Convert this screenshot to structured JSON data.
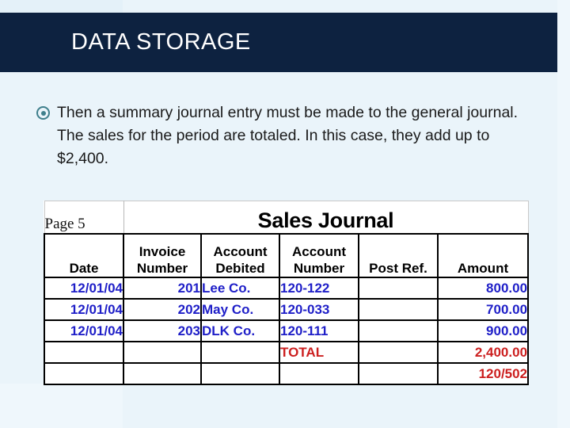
{
  "slide": {
    "title": "DATA STORAGE",
    "accent_dark": "#0d2240",
    "background": "#eaf4fa",
    "bullet_color": "#3f7f8c",
    "body_text": "Then a summary journal entry must be made to the general journal. The sales for the period are totaled. In this case, they add up to $2,400.",
    "bullet_icon": "circled-dot-bullet-icon"
  },
  "journal": {
    "page_label": "Page 5",
    "title": "Sales Journal",
    "value_color_blue": "#1f1fc8",
    "value_color_red": "#cc1f1f",
    "columns": [
      {
        "line1": "",
        "line2": "Date"
      },
      {
        "line1": "Invoice",
        "line2": "Number"
      },
      {
        "line1": "Account",
        "line2": "Debited"
      },
      {
        "line1": "Account",
        "line2": "Number"
      },
      {
        "line1": "",
        "line2": "Post Ref."
      },
      {
        "line1": "",
        "line2": "Amount"
      }
    ],
    "rows": [
      {
        "date": "12/01/04",
        "invoice": "201",
        "account_debited": "Lee Co.",
        "account_number": "120-122",
        "post_ref": "",
        "amount": "800.00"
      },
      {
        "date": "12/01/04",
        "invoice": "202",
        "account_debited": "May Co.",
        "account_number": "120-033",
        "post_ref": "",
        "amount": "700.00"
      },
      {
        "date": "12/01/04",
        "invoice": "203",
        "account_debited": "DLK Co.",
        "account_number": "120-111",
        "post_ref": "",
        "amount": "900.00"
      },
      {
        "date": "",
        "invoice": "",
        "account_debited": "",
        "account_number": "TOTAL",
        "post_ref": "",
        "amount": "2,400.00"
      },
      {
        "date": "",
        "invoice": "",
        "account_debited": "",
        "account_number": "",
        "post_ref": "",
        "amount": "120/502"
      }
    ]
  }
}
